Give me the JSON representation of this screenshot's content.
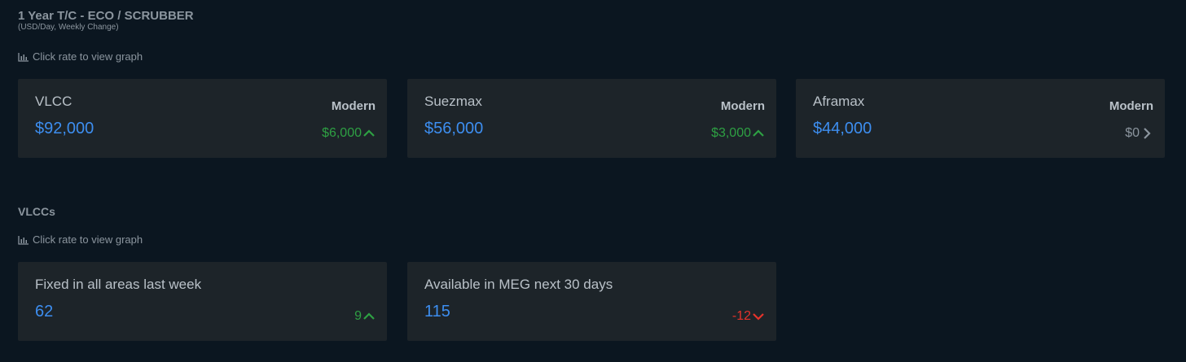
{
  "section1": {
    "title": "1 Year T/C - ECO / SCRUBBER",
    "subtitle": "(USD/Day, Weekly Change)",
    "hint": "Click rate to view graph",
    "cards": [
      {
        "name": "VLCC",
        "tag": "Modern",
        "value": "$92,000",
        "change": "$6,000",
        "direction": "up"
      },
      {
        "name": "Suezmax",
        "tag": "Modern",
        "value": "$56,000",
        "change": "$3,000",
        "direction": "up"
      },
      {
        "name": "Aframax",
        "tag": "Modern",
        "value": "$44,000",
        "change": "$0",
        "direction": "flat"
      }
    ]
  },
  "section2": {
    "title": "VLCCs",
    "hint": "Click rate to view graph",
    "cards": [
      {
        "name": "Fixed in all areas last week",
        "value": "62",
        "change": "9",
        "direction": "up"
      },
      {
        "name": "Available in MEG next 30 days",
        "value": "115",
        "change": "-12",
        "direction": "down"
      }
    ]
  },
  "icons": {
    "hint_icon": "bar-chart-icon",
    "up": "chevron-up-icon",
    "down": "chevron-down-icon",
    "flat": "chevron-right-icon"
  },
  "colors": {
    "background": "#0b1620",
    "card": "#1d2429",
    "value": "#3d8ef0",
    "positive": "#2ea043",
    "negative": "#e5332b",
    "neutral": "#8b959e"
  }
}
